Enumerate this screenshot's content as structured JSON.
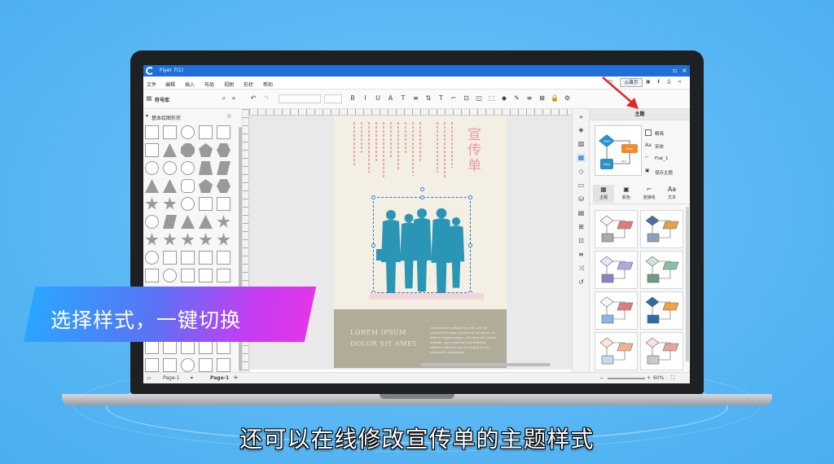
{
  "window": {
    "title": "Flyer 7(1)"
  },
  "menu": [
    "文件",
    "编辑",
    "插入",
    "布局",
    "视图",
    "形状",
    "帮助"
  ],
  "present_label": "演示",
  "toolbar": {
    "library_label": "符号库",
    "fmt_icons": [
      "B",
      "I",
      "U",
      "A",
      "T",
      "≡",
      "⇅",
      "T",
      "⌐",
      "⊡",
      "◫",
      "⬚",
      "◆",
      "✎",
      "≡",
      "⊠",
      "🔒",
      "⚙"
    ]
  },
  "library": {
    "group_title": "基本绘图形状"
  },
  "flyer": {
    "title": "宣传单",
    "bottom_heading": "LOREM IPSUM DOLOR SIT AMET",
    "bottom_body": "Consectetur adipiscing elit, sed do eiusmod tempor incididunt ut labore et dolore magna aliqua. Ut enim ad minim veniam, quis nostrud exercitation ullamco laboris nisi ut aliquip ex ea commodo consequat.",
    "accent": "#e79aa6",
    "figure_color": "#2b95b5"
  },
  "theme_panel": {
    "header": "主题",
    "options": [
      "精简",
      "宋体",
      "Flat_1",
      "保存主题"
    ],
    "tabs": [
      "主题",
      "颜色",
      "连接线",
      "文本"
    ],
    "preview_labels": [
      "Start",
      "Step",
      "Step",
      "Text"
    ]
  },
  "status": {
    "page_sel": "Page-1",
    "page_tab": "Page-1",
    "add": "+",
    "zoom": "60%"
  },
  "overlay": {
    "banner": "选择样式，一键切换",
    "subtitle": "还可以在线修改宣传单的主题样式"
  },
  "colors": {
    "title_bar": "#1e6fd9",
    "banner_start": "#2aa6ff",
    "banner_end": "#e236e9",
    "arrow": "#e3262a"
  }
}
